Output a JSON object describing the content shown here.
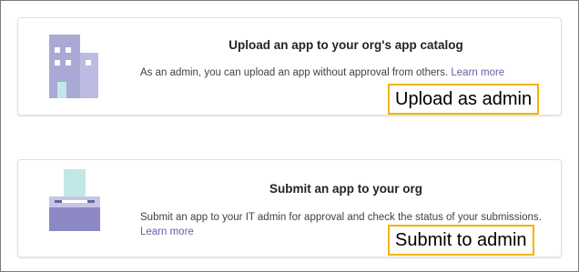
{
  "cards": [
    {
      "title": "Upload an app to your org's app catalog",
      "description": "As an admin, you can upload an app without approval from others.",
      "link": "Learn more",
      "icon": "building-icon"
    },
    {
      "title": "Submit an app to your org",
      "description": "Submit an app to your IT admin for approval and check the status of your submissions.",
      "link": "Learn more",
      "icon": "submit-box-icon"
    }
  ],
  "callouts": {
    "upload": "Upload as admin",
    "submit": "Submit to admin"
  },
  "colors": {
    "accent": "#6264a7",
    "callout_border": "#f2b400",
    "illustration_purple": "#aaa8d4",
    "illustration_teal": "#c2e7e8"
  }
}
